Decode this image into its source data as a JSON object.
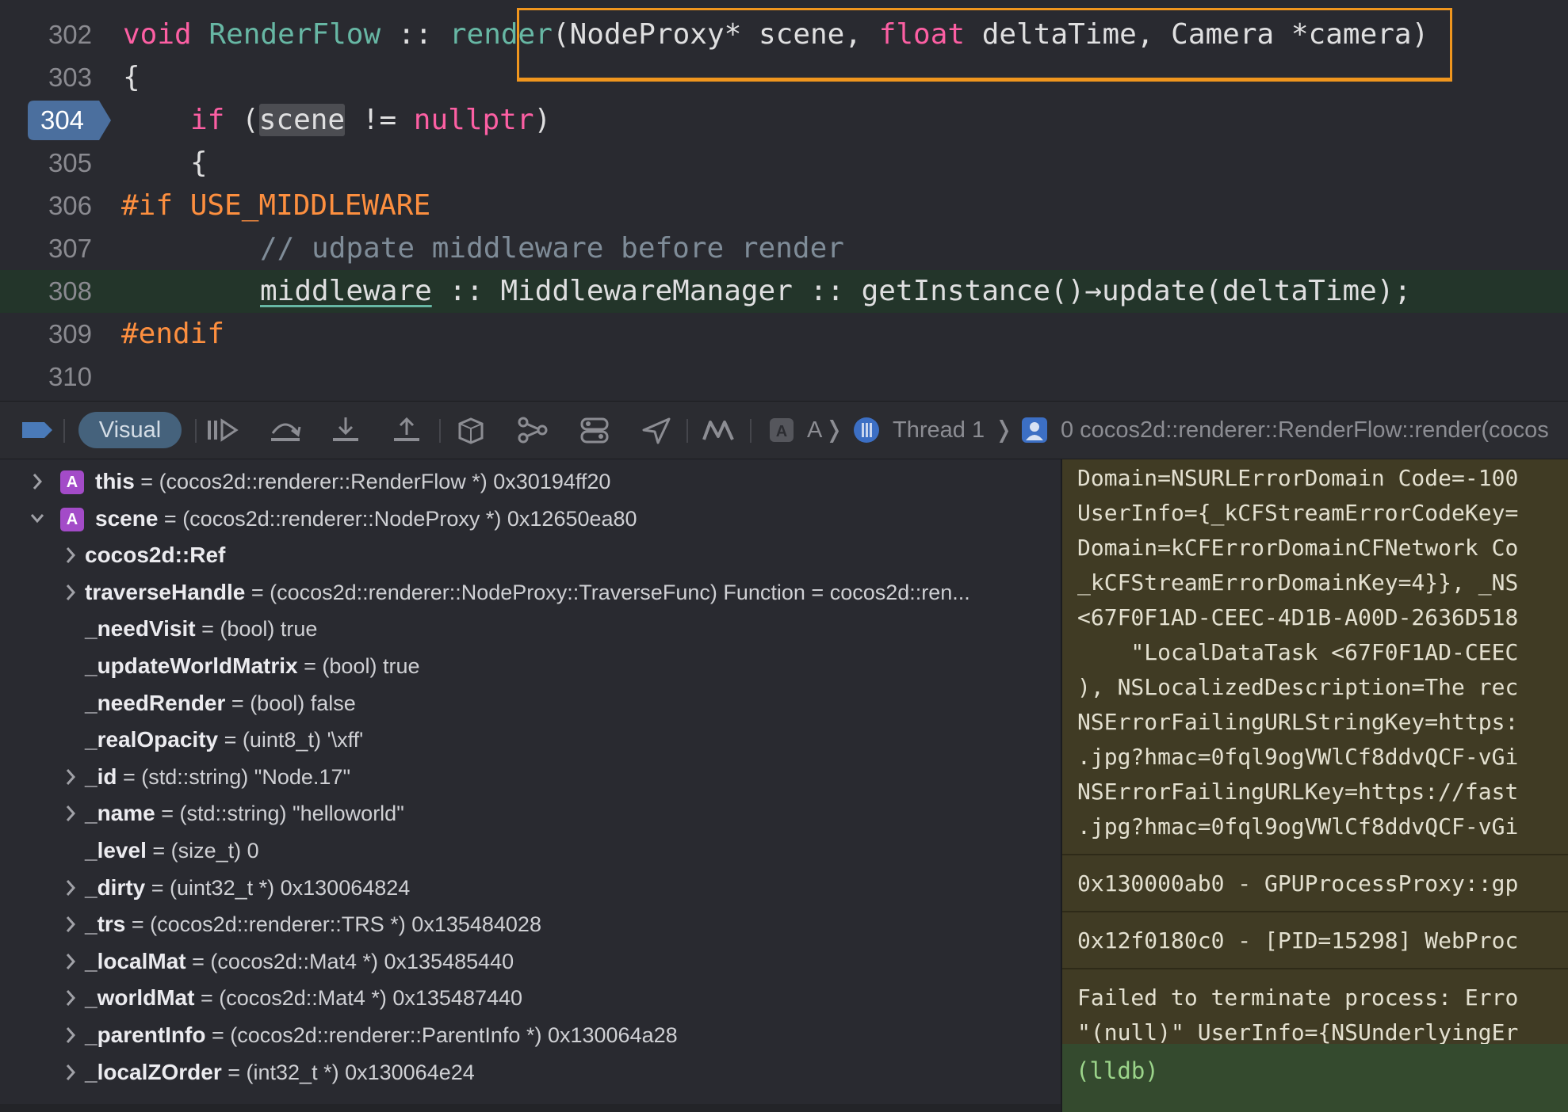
{
  "editor": {
    "lines": [
      {
        "number": "302",
        "tokens": [
          {
            "t": "void",
            "c": "kw"
          },
          {
            "t": " "
          },
          {
            "t": "RenderFlow",
            "c": "fn"
          },
          {
            "t": " :: ",
            "c": "tp"
          },
          {
            "t": "render",
            "c": "fn"
          },
          {
            "t": "(NodeProxy* scene, "
          },
          {
            "t": "float",
            "c": "kw"
          },
          {
            "t": " deltaTime, Camera *camera)"
          }
        ]
      },
      {
        "number": "303",
        "tokens": [
          {
            "t": "{"
          }
        ]
      },
      {
        "number": "304",
        "tokens": [
          {
            "t": "if",
            "c": "kw"
          },
          {
            "t": " ("
          },
          {
            "t": "scene",
            "c": "cur-word"
          },
          {
            "t": " != "
          },
          {
            "t": "nullptr",
            "c": "kw"
          },
          {
            "t": ")"
          }
        ]
      },
      {
        "number": "305",
        "tokens": [
          {
            "t": "{"
          }
        ]
      },
      {
        "number": "306",
        "tokens": [
          {
            "t": "#if USE_MIDDLEWARE",
            "c": "pp"
          }
        ]
      },
      {
        "number": "307",
        "tokens": [
          {
            "t": "// udpate middleware before render",
            "c": "cm"
          }
        ]
      },
      {
        "number": "308",
        "tokens": [
          {
            "t": "middleware",
            "c": "ul"
          },
          {
            "t": " :: MiddlewareManager :: getInstance()→update(deltaTime);"
          }
        ]
      },
      {
        "number": "309",
        "tokens": [
          {
            "t": "#endif",
            "c": "pp"
          }
        ]
      },
      {
        "number": "310",
        "tokens": []
      }
    ],
    "current_line": "304",
    "highlighted_line": "308"
  },
  "toolbar": {
    "visual_label": "Visual",
    "app_icon_label": "A",
    "thread_label": "Thread 1",
    "frame_label": "0 cocos2d::renderer::RenderFlow::render(cocos"
  },
  "variables": [
    {
      "name": "this",
      "type": "(cocos2d::renderer::RenderFlow *)",
      "value": "0x30194ff20",
      "expand": "collapsed",
      "badge": "A",
      "level": 0
    },
    {
      "name": "scene",
      "type": "(cocos2d::renderer::NodeProxy *)",
      "value": "0x12650ea80",
      "expand": "expanded",
      "badge": "A",
      "level": 0
    },
    {
      "name": "cocos2d::Ref",
      "type": "",
      "value": "",
      "expand": "collapsed",
      "badge": "",
      "level": 1
    },
    {
      "name": "traverseHandle",
      "type": "(cocos2d::renderer::NodeProxy::TraverseFunc)",
      "value": " Function = cocos2d::ren...",
      "expand": "collapsed",
      "badge": "",
      "level": 1
    },
    {
      "name": "_needVisit",
      "type": "(bool)",
      "value": "true",
      "expand": "none",
      "badge": "",
      "level": 1
    },
    {
      "name": "_updateWorldMatrix",
      "type": "(bool)",
      "value": "true",
      "expand": "none",
      "badge": "",
      "level": 1
    },
    {
      "name": "_needRender",
      "type": "(bool)",
      "value": "false",
      "expand": "none",
      "badge": "",
      "level": 1
    },
    {
      "name": "_realOpacity",
      "type": "(uint8_t)",
      "value": "'\\xff'",
      "expand": "none",
      "badge": "",
      "level": 1
    },
    {
      "name": "_id",
      "type": "(std::string)",
      "value": "\"Node.17\"",
      "expand": "collapsed",
      "badge": "",
      "level": 1
    },
    {
      "name": "_name",
      "type": "(std::string)",
      "value": "\"helloworld\"",
      "expand": "collapsed",
      "badge": "",
      "level": 1
    },
    {
      "name": "_level",
      "type": "(size_t)",
      "value": "0",
      "expand": "none",
      "badge": "",
      "level": 1
    },
    {
      "name": "_dirty",
      "type": "(uint32_t *)",
      "value": "0x130064824",
      "expand": "collapsed",
      "badge": "",
      "level": 1
    },
    {
      "name": "_trs",
      "type": "(cocos2d::renderer::TRS *)",
      "value": "0x135484028",
      "expand": "collapsed",
      "badge": "",
      "level": 1
    },
    {
      "name": "_localMat",
      "type": "(cocos2d::Mat4 *)",
      "value": "0x135485440",
      "expand": "collapsed",
      "badge": "",
      "level": 1
    },
    {
      "name": "_worldMat",
      "type": "(cocos2d::Mat4 *)",
      "value": "0x135487440",
      "expand": "collapsed",
      "badge": "",
      "level": 1
    },
    {
      "name": "_parentInfo",
      "type": "(cocos2d::renderer::ParentInfo *)",
      "value": "0x130064a28",
      "expand": "collapsed",
      "badge": "",
      "level": 1
    },
    {
      "name": "_localZOrder",
      "type": "(int32_t *)",
      "value": "0x130064e24",
      "expand": "collapsed",
      "badge": "",
      "level": 1
    }
  ],
  "console": {
    "entries": [
      {
        "lines": [
          "Domain=NSURLErrorDomain Code=-100",
          "UserInfo={_kCFStreamErrorCodeKey=",
          "Domain=kCFErrorDomainCFNetwork Co",
          "_kCFStreamErrorDomainKey=4}}, _NS",
          "<67F0F1AD-CEEC-4D1B-A00D-2636D518",
          "    \"LocalDataTask <67F0F1AD-CEEC",
          "), NSLocalizedDescription=The rec",
          "NSErrorFailingURLStringKey=https:",
          ".jpg?hmac=0fql9ogVWlCf8ddvQCF-vGi",
          "NSErrorFailingURLKey=https://fast",
          ".jpg?hmac=0fql9ogVWlCf8ddvQCF-vGi"
        ]
      },
      {
        "lines": [
          "0x130000ab0 - GPUProcessProxy::gp"
        ]
      },
      {
        "lines": [
          "0x12f0180c0 - [PID=15298] WebProc"
        ]
      },
      {
        "lines": [
          "Failed to terminate process: Erro",
          "\"(null)\" UserInfo={NSUnderlyingEr"
        ]
      }
    ],
    "prompt": "(lldb)"
  },
  "colors": {
    "editor_bg": "#292a30",
    "keyword": "#fc5fa3",
    "function": "#67b7a4",
    "preprocessor": "#fd8f3f",
    "comment": "#7f8c98",
    "highlight_box": "#f0961e",
    "console_bg": "#403b24",
    "lldb_prompt": "#9bd48a"
  }
}
